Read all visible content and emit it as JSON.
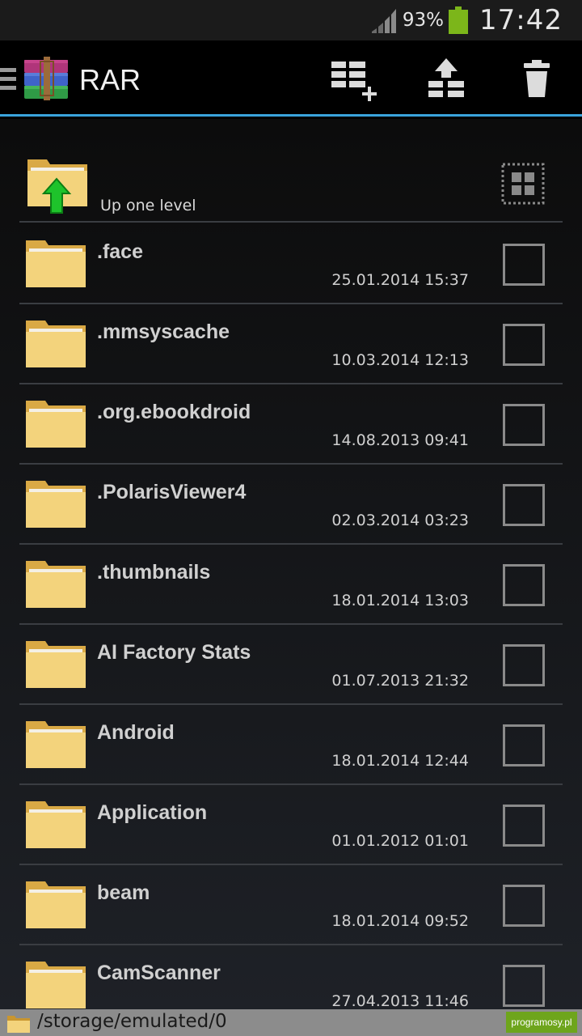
{
  "status_bar": {
    "battery_percent": "93%",
    "time": "17:42",
    "battery_color": "#7cb61a"
  },
  "action_bar": {
    "title": "RAR",
    "accent_color": "#3aa4dc",
    "icons": [
      "menu-icon",
      "winrar-logo",
      "add-to-archive-icon",
      "extract-icon",
      "delete-icon"
    ]
  },
  "up_level": {
    "label": "Up one level"
  },
  "files": [
    {
      "name": ".face",
      "date": "25.01.2014 15:37"
    },
    {
      "name": ".mmsyscache",
      "date": "10.03.2014 12:13"
    },
    {
      "name": ".org.ebookdroid",
      "date": "14.08.2013 09:41"
    },
    {
      "name": ".PolarisViewer4",
      "date": "02.03.2014 03:23"
    },
    {
      "name": ".thumbnails",
      "date": "18.01.2014 13:03"
    },
    {
      "name": "AI Factory Stats",
      "date": "01.07.2013 21:32"
    },
    {
      "name": "Android",
      "date": "18.01.2014 12:44"
    },
    {
      "name": "Application",
      "date": "01.01.2012 01:01"
    },
    {
      "name": "beam",
      "date": "18.01.2014 09:52"
    },
    {
      "name": "CamScanner",
      "date": "27.04.2013 11:46"
    }
  ],
  "path_bar": {
    "path": "/storage/emulated/0",
    "watermark": "programosy.pl"
  }
}
